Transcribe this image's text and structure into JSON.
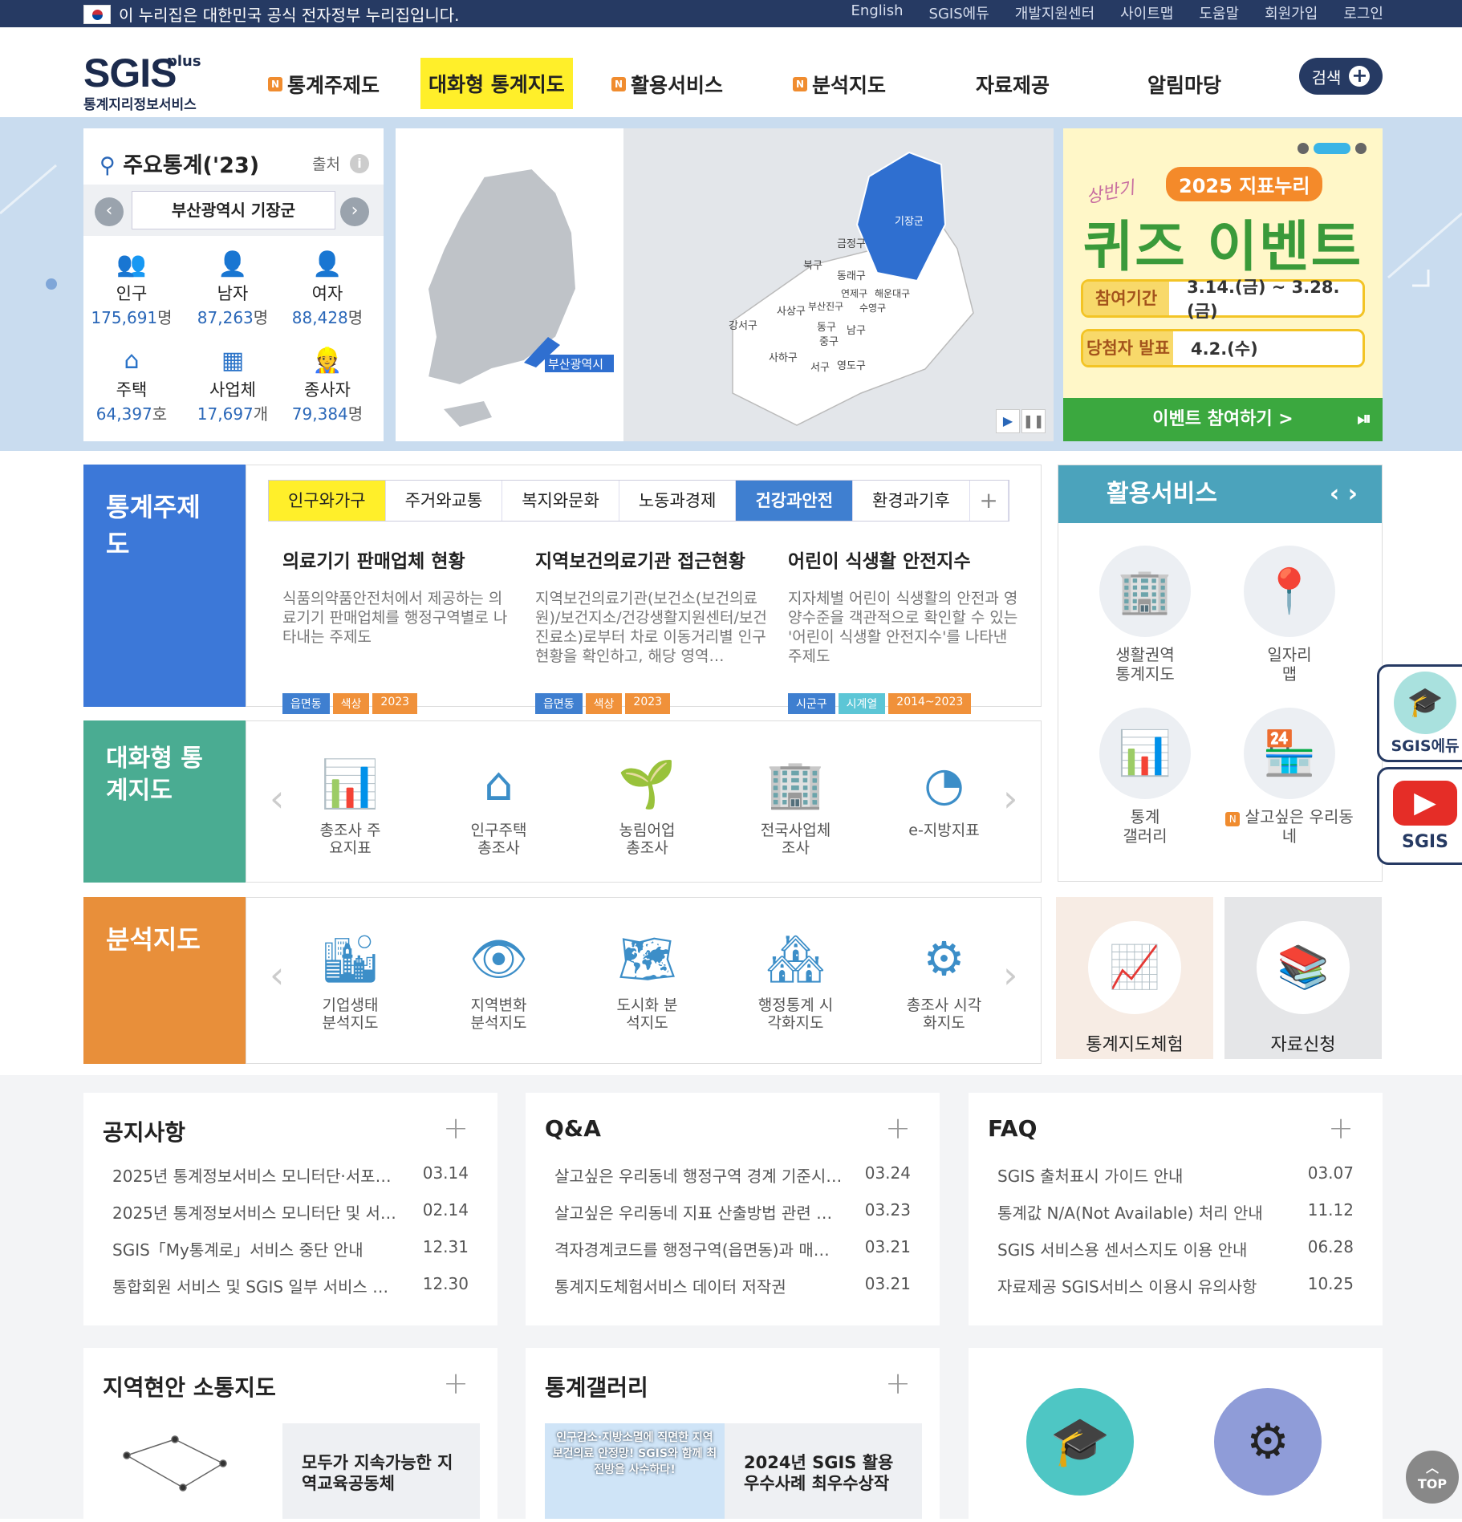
{
  "gov_banner": "이 누리집은 대한민국 공식 전자정부 누리집입니다.",
  "top_links": [
    "English",
    "SGIS에듀",
    "개발지원센터",
    "사이트맵",
    "도움말",
    "회원가입",
    "로그인"
  ],
  "logo": {
    "main": "SGIS",
    "plus": "plus",
    "sub": "통계지리정보서비스"
  },
  "gnb": [
    {
      "label": "통계주제도",
      "badge": "N"
    },
    {
      "label": "대화형 통계지도",
      "badge": ""
    },
    {
      "label": "활용서비스",
      "badge": "N"
    },
    {
      "label": "분석지도",
      "badge": "N"
    },
    {
      "label": "자료제공",
      "badge": ""
    },
    {
      "label": "알림마당",
      "badge": ""
    }
  ],
  "search_label": "검색",
  "stats": {
    "title": "주요통계('23)",
    "source": "출처",
    "region": "부산광역시 기장군",
    "items": [
      {
        "label": "인구",
        "value": "175,691",
        "unit": "명",
        "icon": "people-icon"
      },
      {
        "label": "남자",
        "value": "87,263",
        "unit": "명",
        "icon": "man-icon"
      },
      {
        "label": "여자",
        "value": "88,428",
        "unit": "명",
        "icon": "woman-icon"
      },
      {
        "label": "주택",
        "value": "64,397",
        "unit": "호",
        "icon": "house-icon"
      },
      {
        "label": "사업체",
        "value": "17,697",
        "unit": "개",
        "icon": "building-icon"
      },
      {
        "label": "종사자",
        "value": "79,384",
        "unit": "명",
        "icon": "worker-icon"
      }
    ]
  },
  "map": {
    "highlight_label": "부산광역시",
    "selected_district": "기장군",
    "districts": [
      "금정구",
      "북구",
      "동래구",
      "연제구",
      "해운대구",
      "사상구",
      "부산진구",
      "수영구",
      "강서구",
      "동구",
      "남구",
      "중구",
      "사하구",
      "서구",
      "영도구"
    ]
  },
  "event": {
    "sub": "상반기",
    "badge": "2025 지표누리",
    "title": "퀴즈 이벤트",
    "rows": [
      {
        "k": "참여기간",
        "v": "3.14.(금) ~ 3.28.(금)"
      },
      {
        "k": "당첨자 발표",
        "v": "4.2.(수)"
      }
    ],
    "button": "이벤트 참여하기 >"
  },
  "theme_map": {
    "label": "통계주제도",
    "tabs": [
      "인구와가구",
      "주거와교통",
      "복지와문화",
      "노동과경제",
      "건강과안전",
      "환경과기후",
      "+"
    ],
    "cards": [
      {
        "title": "의료기기 판매업체 현황",
        "desc": "식품의약품안전처에서 제공하는 의료기기 판매업체를 행정구역별로 나타내는 주제도",
        "tags": [
          "읍면동",
          "색상",
          "2023"
        ]
      },
      {
        "title": "지역보건의료기관 접근현황",
        "desc": "지역보건의료기관(보건소(보건의료원)/보건지소/건강생활지원센터/보건진료소)로부터 차로 이동거리별 인구현황을 확인하고, 해당 영역…",
        "tags": [
          "읍면동",
          "색상",
          "2023"
        ]
      },
      {
        "title": "어린이 식생활 안전지수",
        "desc": "지자체별 어린이 식생활의 안전과 영양수준을 객관적으로 확인할 수 있는 '어린이 식생활 안전지수'를 나타낸 주제도",
        "tags": [
          "시군구",
          "시계열",
          "2014~2023"
        ]
      }
    ]
  },
  "interactive_map": {
    "label": "대화형 통계지도",
    "items": [
      {
        "label": "총조사 주요지표",
        "icon": "chart-up-icon"
      },
      {
        "label": "인구주택 총조사",
        "icon": "house-person-icon"
      },
      {
        "label": "농림어업 총조사",
        "icon": "sprout-icon"
      },
      {
        "label": "전국사업체 조사",
        "icon": "office-building-icon"
      },
      {
        "label": "e-지방지표",
        "icon": "pie-bar-icon"
      }
    ]
  },
  "analysis_map": {
    "label": "분석지도",
    "items": [
      {
        "label": "기업생태 분석지도",
        "icon": "enterprise-icon"
      },
      {
        "label": "지역변화 분석지도",
        "icon": "region-change-icon"
      },
      {
        "label": "도시화 분석지도",
        "icon": "urban-icon"
      },
      {
        "label": "행정통계 시각화지도",
        "icon": "admin-stat-icon"
      },
      {
        "label": "총조사 시각화지도",
        "icon": "census-visual-icon"
      }
    ]
  },
  "services": {
    "title": "활용서비스",
    "items": [
      {
        "label": "생활권역 통계지도",
        "badge": "",
        "icon": "living-area-icon"
      },
      {
        "label": "일자리 맵",
        "badge": "",
        "icon": "job-pin-icon"
      },
      {
        "label": "통계 갤러리",
        "badge": "",
        "icon": "gallery-icon"
      },
      {
        "label": "살고싶은 우리동네",
        "badge": "N",
        "icon": "shop-icon"
      }
    ],
    "box_items": [
      "통계지도체험",
      "자료신청"
    ]
  },
  "boards": [
    {
      "title": "공지사항",
      "rows": [
        {
          "t": "2025년 통계정보서비스 모니터단·서포…",
          "d": "03.14"
        },
        {
          "t": "2025년 통계정보서비스 모니터단 및 서…",
          "d": "02.14"
        },
        {
          "t": "SGIS「My통계로」서비스 중단 안내",
          "d": "12.31"
        },
        {
          "t": "통합회원 서비스 및 SGIS 일부 서비스 일…",
          "d": "12.30"
        }
      ]
    },
    {
      "title": "Q&A",
      "rows": [
        {
          "t": "살고싶은 우리동네 행정구역 경계 기준시…",
          "d": "03.24"
        },
        {
          "t": "살고싶은 우리동네 지표 산출방법 관련 …",
          "d": "03.23"
        },
        {
          "t": "격자경계코드를 행정구역(읍면동)과 매…",
          "d": "03.21"
        },
        {
          "t": "통계지도체험서비스 데이터 저작권",
          "d": "03.21"
        }
      ]
    },
    {
      "title": "FAQ",
      "rows": [
        {
          "t": "SGIS 출처표시 가이드 안내",
          "d": "03.07"
        },
        {
          "t": "통계값 N/A(Not Available) 처리 안내",
          "d": "11.12"
        },
        {
          "t": "SGIS 서비스용 센서스지도 이용 안내",
          "d": "06.28"
        },
        {
          "t": "자료제공 SGIS서비스 이용시 유의사항",
          "d": "10.25"
        }
      ]
    }
  ],
  "bottom": {
    "community": {
      "title": "지역현안 소통지도",
      "text": "모두가 지속가능한 지역교육공동체"
    },
    "gallery": {
      "title": "통계갤러리",
      "banner": "인구감소·지방소멸에 직면한 지역 보건의료 안정망! SGIS와 함께 최전방을 사수하다!",
      "text": "2024년 SGIS 활용 우수사례 최우수상작"
    }
  },
  "side": {
    "edu": "SGIS에듀",
    "sgis": "SGIS"
  },
  "top_button": "TOP"
}
